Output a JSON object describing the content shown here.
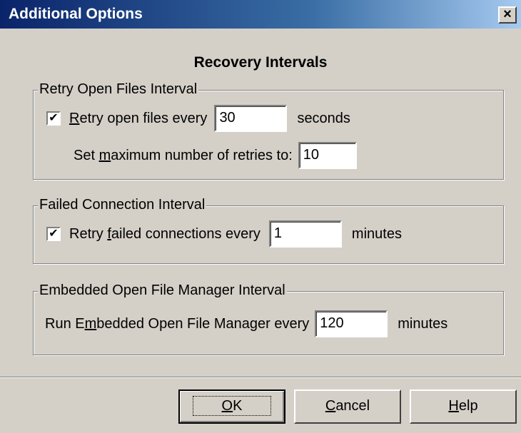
{
  "window": {
    "title": "Additional Options",
    "close_glyph": "×"
  },
  "heading": "Recovery Intervals",
  "retry_open_files": {
    "legend": "Retry Open Files Interval",
    "checkbox_checked": true,
    "check_glyph": "✔",
    "label_pre": "",
    "label_mnemonic": "R",
    "label_post": "etry open files every",
    "interval_value": "30",
    "unit": "seconds",
    "max_label_pre": "Set ",
    "max_label_mnemonic": "m",
    "max_label_post": "aximum number of retries to:",
    "max_value": "10"
  },
  "failed_connection": {
    "legend": "Failed Connection Interval",
    "checkbox_checked": true,
    "check_glyph": "✔",
    "label_pre": "Retry ",
    "label_mnemonic": "f",
    "label_post": "ailed connections every",
    "interval_value": "1",
    "unit": "minutes"
  },
  "open_file_manager": {
    "legend": "Embedded Open File Manager Interval",
    "label_pre": "Run E",
    "label_mnemonic": "m",
    "label_post": "bedded Open File Manager every",
    "interval_value": "120",
    "unit": "minutes"
  },
  "buttons": {
    "ok_mnemonic": "O",
    "ok_rest": "K",
    "cancel_mnemonic": "C",
    "cancel_rest": "ancel",
    "help_mnemonic": "H",
    "help_rest": "elp"
  }
}
